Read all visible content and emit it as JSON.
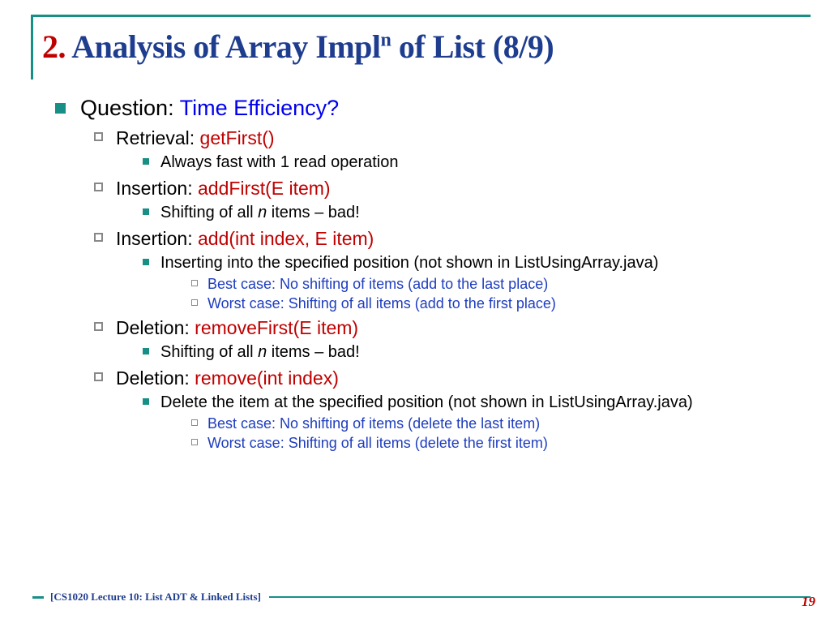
{
  "title": {
    "num": "2.",
    "main_a": " Analysis of Array Impl",
    "sup": "n",
    "main_b": " of List (8/9)"
  },
  "l1": {
    "prefix": "Question: ",
    "blue": "Time Efficiency?"
  },
  "items": [
    {
      "label": "Retrieval: ",
      "method": "getFirst()",
      "sub": [
        {
          "text": "Always fast with 1 read operation"
        }
      ]
    },
    {
      "label": "Insertion: ",
      "method": "addFirst(E item)",
      "sub": [
        {
          "pre": "Shifting of all ",
          "it": "n ",
          "post": "items – bad!"
        }
      ]
    },
    {
      "label": "Insertion: ",
      "method": "add(int index, E item)",
      "sub": [
        {
          "text": "Inserting into the specified position (not shown in ListUsingArray.java)",
          "cases": [
            "Best case: No shifting of items (add to the last place)",
            "Worst case: Shifting of all items (add to the first place)"
          ]
        }
      ]
    },
    {
      "label": "Deletion: ",
      "method": "removeFirst(E item)",
      "sub": [
        {
          "pre": "Shifting of all ",
          "it": "n ",
          "post": "items – bad!"
        }
      ]
    },
    {
      "label": "Deletion: ",
      "method": "remove(int index)",
      "sub": [
        {
          "text": "Delete the item at the specified position (not shown in ListUsingArray.java)",
          "cases": [
            "Best case: No shifting of items (delete the last item)",
            "Worst case: Shifting of all items (delete the first item)"
          ]
        }
      ]
    }
  ],
  "footer": "[CS1020 Lecture 10: List ADT & Linked Lists]",
  "page": "19"
}
